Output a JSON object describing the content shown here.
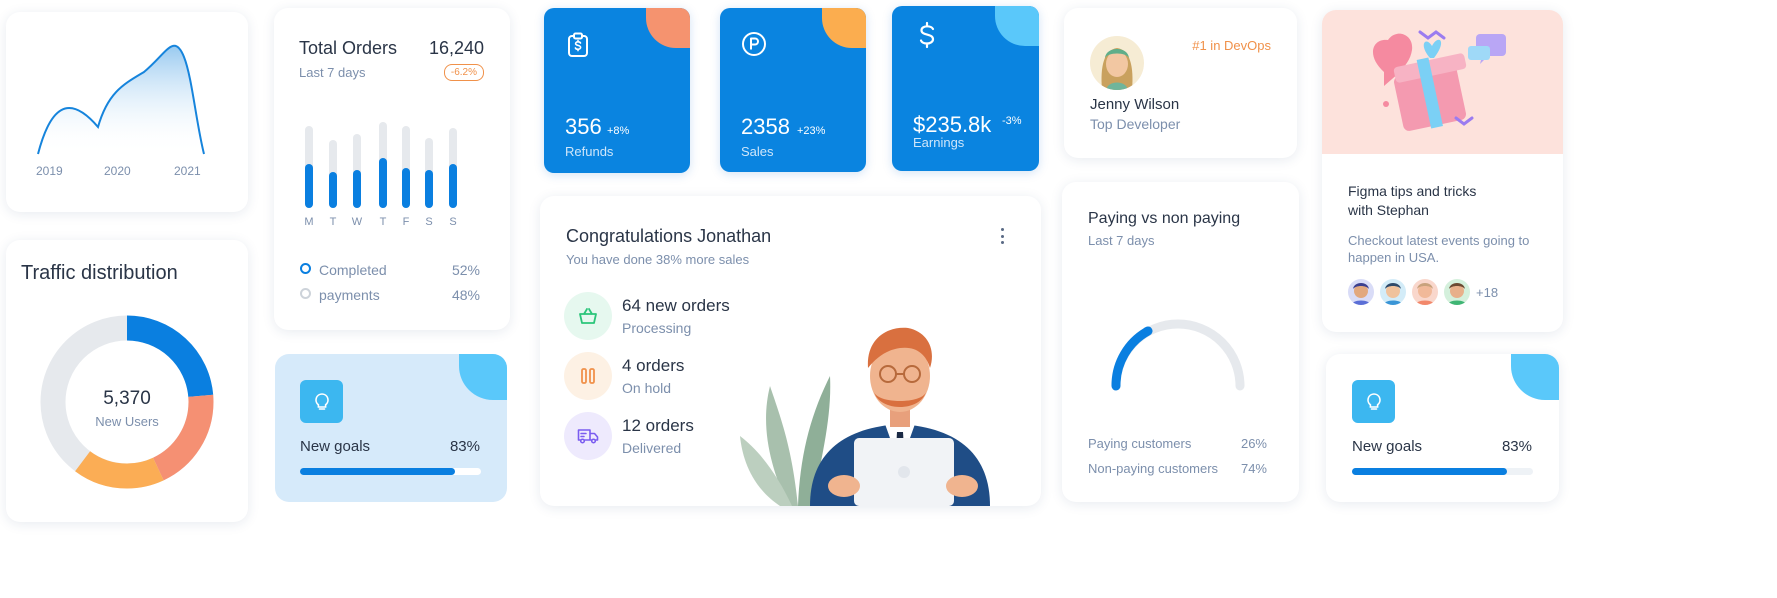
{
  "colors": {
    "primary": "#0a84e0",
    "accent_orange": "#f0914a",
    "accent_green": "#2bc57a",
    "accent_purple": "#7a5cf0",
    "donut_blue": "#0a7fe0",
    "donut_orange": "#fbad55",
    "donut_red": "#f59073",
    "donut_grey": "#e6e9ed"
  },
  "growth": {
    "labels": [
      "2019",
      "2020",
      "2021"
    ]
  },
  "traffic": {
    "title": "Traffic distribution",
    "value": "5,370",
    "caption": "New Users"
  },
  "orders": {
    "title": "Total Orders",
    "value": "16,240",
    "subtitle": "Last 7 days",
    "badge": "-6.2%",
    "days": [
      "M",
      "T",
      "W",
      "T",
      "F",
      "S",
      "S"
    ],
    "legend": [
      {
        "label": "Completed",
        "pct": "52%"
      },
      {
        "label": "payments",
        "pct": "48%"
      }
    ]
  },
  "goals_left": {
    "label": "New goals",
    "pct": "83%",
    "progress": 0.83
  },
  "stats": [
    {
      "icon": "clipboard-dollar-icon",
      "value": "356",
      "change": "+8%",
      "label": "Refunds",
      "blob": "#f5936f"
    },
    {
      "icon": "parking-coin-icon",
      "value": "2358",
      "change": "+23%",
      "label": "Sales",
      "blob": "#fbad4f"
    },
    {
      "icon": "dollar-icon",
      "value": "$235.8k",
      "change": "-3%",
      "label": "Earnings",
      "blob": "#5ac8fa"
    }
  ],
  "congrats": {
    "title": "Congratulations Jonathan",
    "subtitle": "You have done 38% more sales",
    "items": [
      {
        "icon": "basket-icon",
        "title": "64 new orders",
        "sub": "Processing"
      },
      {
        "icon": "pause-icon",
        "title": "4 orders",
        "sub": "On hold"
      },
      {
        "icon": "truck-icon",
        "title": "12 orders",
        "sub": "Delivered"
      }
    ]
  },
  "profile": {
    "rank": "#1 in DevOps",
    "name": "Jenny Wilson",
    "role": "Top Developer"
  },
  "paying": {
    "title": "Paying vs non paying",
    "subtitle": "Last 7 days",
    "rows": [
      {
        "label": "Paying customers",
        "pct": "26%"
      },
      {
        "label": "Non-paying customers",
        "pct": "74%"
      }
    ]
  },
  "event": {
    "title": "Figma tips and tricks with Stephan",
    "text": "Checkout latest events going to happen in USA.",
    "more": "+18"
  },
  "goals_right": {
    "label": "New goals",
    "pct": "83%",
    "progress": 0.83
  }
}
